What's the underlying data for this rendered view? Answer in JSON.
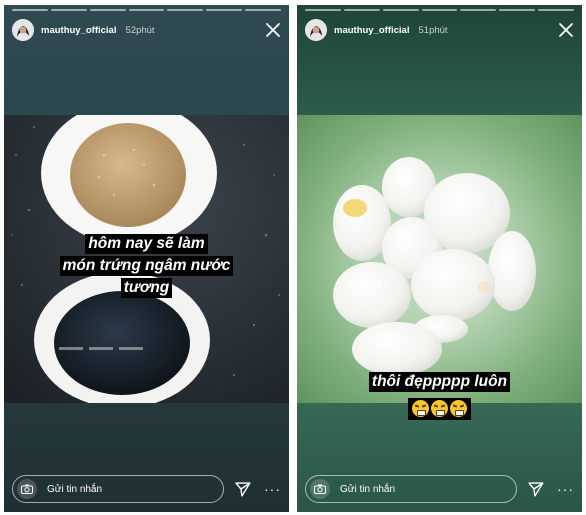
{
  "stories": [
    {
      "username": "mauthuy_official",
      "time": "52phút",
      "caption_lines": [
        "hôm nay sẽ làm",
        "món trứng ngâm nước",
        "tương"
      ],
      "reply_placeholder": "Gửi tin nhắn",
      "more_label": "···"
    },
    {
      "username": "mauthuy_official",
      "time": "51phút",
      "caption_lines": [
        "thôi đẹppppp luôn"
      ],
      "emoji": [
        "persevering-face",
        "persevering-face",
        "persevering-face"
      ],
      "reply_placeholder": "Gửi tin nhắn",
      "more_label": "···"
    }
  ],
  "colors": {
    "caption_bg": "#000000",
    "caption_text": "#ffffff",
    "left_story_bg": "#2c474d",
    "right_story_bg": "#3f7a63"
  }
}
